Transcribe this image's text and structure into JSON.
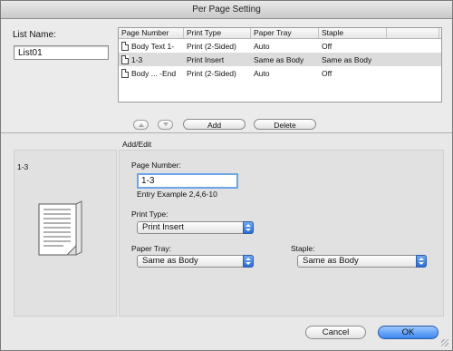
{
  "window": {
    "title": "Per Page Setting"
  },
  "list_name": {
    "label": "List Name:",
    "value": "List01"
  },
  "table": {
    "headers": [
      "Page Number",
      "Print Type",
      "Paper Tray",
      "Staple"
    ],
    "rows": [
      {
        "page": "Body Text 1-",
        "type": "Print (2-Sided)",
        "tray": "Auto",
        "staple": "Off"
      },
      {
        "page": "1-3",
        "type": "Print Insert",
        "tray": "Same as Body",
        "staple": "Same as Body"
      },
      {
        "page": "Body ... -End",
        "type": "Print (2-Sided)",
        "tray": "Auto",
        "staple": "Off"
      }
    ]
  },
  "buttons": {
    "add": "Add",
    "delete": "Delete",
    "cancel": "Cancel",
    "ok": "OK"
  },
  "add_edit": {
    "section_label": "Add/Edit",
    "current_page": "1-3",
    "page_number_label": "Page Number:",
    "page_number_value": "1-3",
    "entry_example": "Entry Example 2,4,6-10",
    "print_type_label": "Print Type:",
    "print_type_value": "Print Insert",
    "paper_tray_label": "Paper Tray:",
    "paper_tray_value": "Same as Body",
    "staple_label": "Staple:",
    "staple_value": "Same as Body"
  },
  "icons": [
    "document-icon",
    "up-arrow-icon",
    "down-arrow-icon",
    "page-preview-icon",
    "popup-arrows-icon",
    "resize-grip-icon"
  ],
  "colors": {
    "accent": "#3a87ef",
    "focus": "#6ba5e7"
  }
}
